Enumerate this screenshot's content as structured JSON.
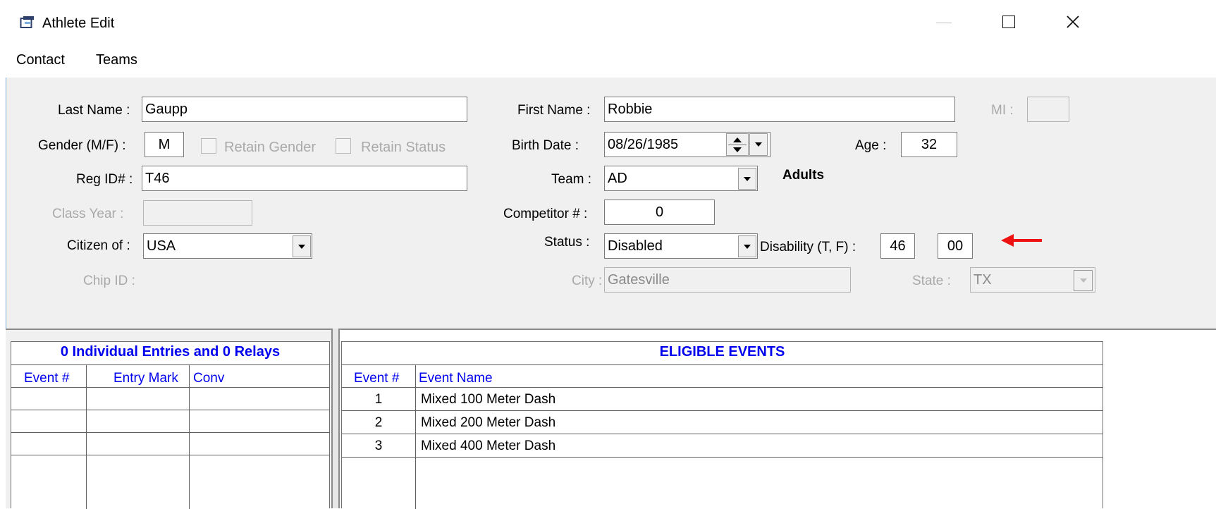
{
  "window": {
    "title": "Athlete Edit"
  },
  "menu": [
    "Contact",
    "Teams"
  ],
  "form": {
    "last_name_label": "Last Name :",
    "last_name": "Gaupp",
    "first_name_label": "First Name :",
    "first_name": "Robbie",
    "mi_label": "MI :",
    "mi": "",
    "gender_label": "Gender (M/F) :",
    "gender": "M",
    "retain_gender_label": "Retain Gender",
    "retain_status_label": "Retain Status",
    "birth_date_label": "Birth Date :",
    "birth_date": "08/26/1985",
    "age_label": "Age :",
    "age": "32",
    "reg_id_label": "Reg ID# :",
    "reg_id": "T46",
    "team_label": "Team :",
    "team": "AD",
    "team_name": "Adults",
    "class_year_label": "Class Year :",
    "class_year": "",
    "competitor_label": "Competitor # :",
    "competitor": "0",
    "citizen_label": "Citizen of :",
    "citizen": "USA",
    "status_label": "Status :",
    "status": "Disabled",
    "disability_label": "Disability (T, F) :",
    "disability_t": "46",
    "disability_f": "00",
    "chip_id_label": "Chip ID :",
    "city_label": "City :",
    "city": "Gatesville",
    "state_label": "State :",
    "state": "TX"
  },
  "entries": {
    "title": "0 Individual Entries and 0 Relays",
    "columns": [
      "Event #",
      "Entry Mark",
      "Conv"
    ]
  },
  "eligible": {
    "title": "ELIGIBLE EVENTS",
    "columns": [
      "Event #",
      "Event Name"
    ],
    "rows": [
      {
        "num": "1",
        "name": "Mixed 100 Meter Dash"
      },
      {
        "num": "2",
        "name": "Mixed 200 Meter Dash"
      },
      {
        "num": "3",
        "name": "Mixed 400 Meter Dash"
      }
    ]
  },
  "colors": {
    "annotation_arrow": "#ee1111",
    "grid_header": "#0000ee",
    "form_bg": "#f0f0f0"
  }
}
